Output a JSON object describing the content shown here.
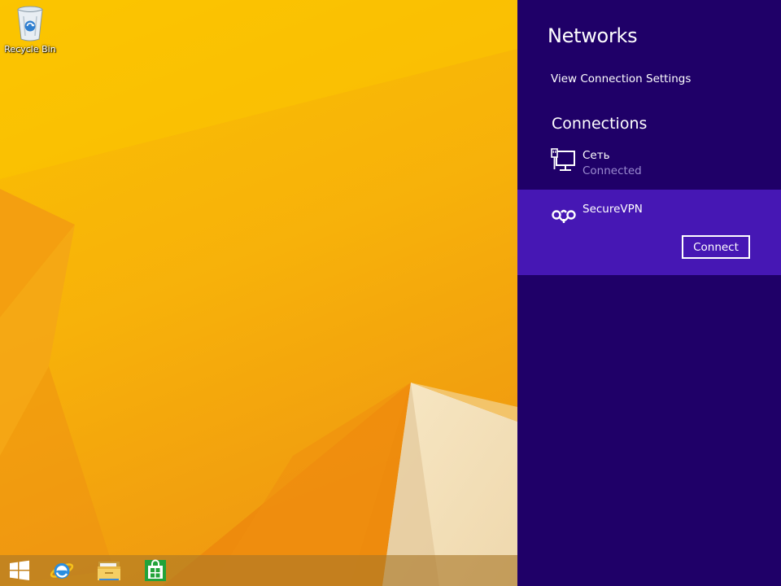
{
  "desktop": {
    "icons": [
      {
        "label": "Recycle Bin",
        "icon": "recycle-bin-icon"
      }
    ]
  },
  "taskbar": {
    "items": [
      {
        "name": "start",
        "icon": "windows-logo-icon"
      },
      {
        "name": "internet-explorer",
        "icon": "internet-explorer-icon"
      },
      {
        "name": "file-explorer",
        "icon": "folder-icon"
      },
      {
        "name": "store",
        "icon": "store-bag-icon"
      }
    ]
  },
  "networks_panel": {
    "title": "Networks",
    "view_settings_label": "View Connection Settings",
    "connections_heading": "Connections",
    "connections": [
      {
        "name": "Сеть",
        "status": "Connected",
        "icon": "wired-network-icon"
      },
      {
        "name": "SecureVPN",
        "icon": "vpn-icon",
        "selected": true,
        "action_label": "Connect"
      }
    ]
  },
  "colors": {
    "panel_bg": "#1f0068",
    "selected_item_bg": "#4617b4",
    "status_text": "#9b8bd0",
    "wallpaper": "#f6b90a"
  }
}
